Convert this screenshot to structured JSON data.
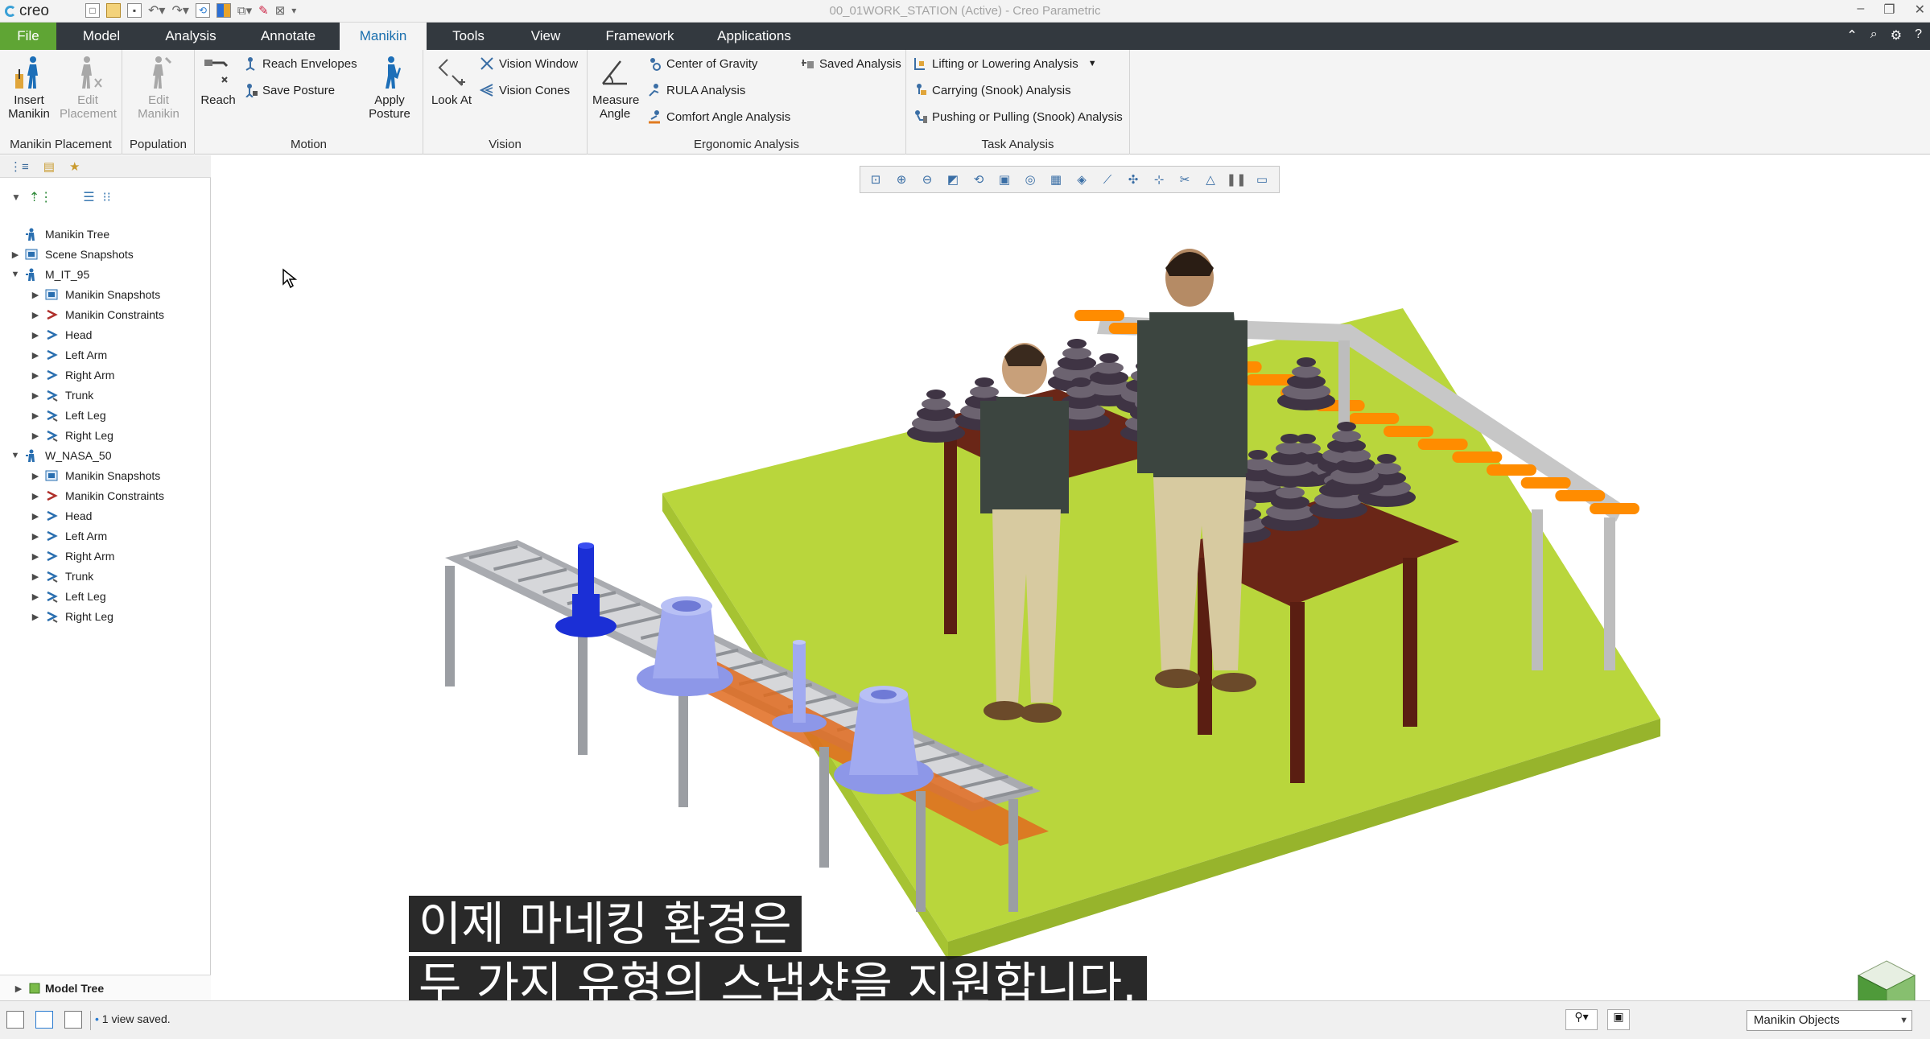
{
  "titlebar": {
    "logo": "creo",
    "title": "00_01WORK_STATION (Active) - Creo Parametric"
  },
  "tabs": [
    "File",
    "Model",
    "Analysis",
    "Annotate",
    "Manikin",
    "Tools",
    "View",
    "Framework",
    "Applications"
  ],
  "active_tab": "Manikin",
  "ribbon": {
    "placement": {
      "insert_manikin": "Insert\nManikin",
      "edit_placement": "Edit\nPlacement",
      "label": "Manikin Placement"
    },
    "population": {
      "edit_manikin": "Edit\nManikin",
      "label": "Population"
    },
    "motion": {
      "reach": "Reach",
      "reach_envelopes": "Reach Envelopes",
      "save_posture": "Save Posture",
      "apply_posture": "Apply\nPosture",
      "label": "Motion"
    },
    "vision": {
      "look_at": "Look At",
      "vision_window": "Vision Window",
      "vision_cones": "Vision Cones",
      "label": "Vision"
    },
    "ergonomic": {
      "measure_angle": "Measure\nAngle",
      "center_of_gravity": "Center of Gravity",
      "rula_analysis": "RULA Analysis",
      "comfort_angle_analysis": "Comfort Angle Analysis",
      "saved_analysis": "Saved Analysis",
      "label": "Ergonomic Analysis"
    },
    "task": {
      "lifting": "Lifting or Lowering Analysis",
      "carrying": "Carrying (Snook) Analysis",
      "pushing": "Pushing or Pulling (Snook) Analysis",
      "label": "Task Analysis"
    }
  },
  "tree": {
    "root": "Manikin Tree",
    "scene_snapshots": "Scene Snapshots",
    "manikins": [
      {
        "name": "M_IT_95",
        "children": [
          "Manikin Snapshots",
          "Manikin Constraints",
          "Head",
          "Left Arm",
          "Right Arm",
          "Trunk",
          "Left Leg",
          "Right Leg"
        ]
      },
      {
        "name": "W_NASA_50",
        "children": [
          "Manikin Snapshots",
          "Manikin Constraints",
          "Head",
          "Left Arm",
          "Right Arm",
          "Trunk",
          "Left Leg",
          "Right Leg"
        ]
      }
    ],
    "model_tree": "Model Tree"
  },
  "subtitles": {
    "line1": "이제 마네킹 환경은",
    "line2": "두 가지 유형의 스냅샷을 지원합니다."
  },
  "status": {
    "message": "1 view saved.",
    "filter": "Manikin Objects"
  },
  "colors": {
    "file_tab": "#5fa534",
    "tab_bar": "#33393f",
    "active_tab_text": "#1a6fae",
    "floor": "#b9d63c",
    "conveyor": "#ff8c00"
  }
}
